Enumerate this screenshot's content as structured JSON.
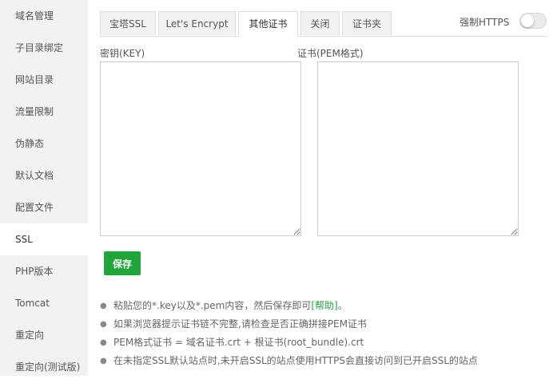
{
  "sidebar": {
    "items": [
      {
        "label": "域名管理"
      },
      {
        "label": "子目录绑定"
      },
      {
        "label": "网站目录"
      },
      {
        "label": "流量限制"
      },
      {
        "label": "伪静态"
      },
      {
        "label": "默认文档"
      },
      {
        "label": "配置文件"
      },
      {
        "label": "SSL"
      },
      {
        "label": "PHP版本"
      },
      {
        "label": "Tomcat"
      },
      {
        "label": "重定向"
      },
      {
        "label": "重定向(测试版)"
      }
    ],
    "active": "SSL"
  },
  "tabs": [
    {
      "label": "宝塔SSL"
    },
    {
      "label": "Let's Encrypt"
    },
    {
      "label": "其他证书"
    },
    {
      "label": "关闭"
    },
    {
      "label": "证书夹"
    }
  ],
  "active_tab": "其他证书",
  "force_https": {
    "label": "强制HTTPS",
    "enabled": false
  },
  "key_field": {
    "label": "密钥(KEY)",
    "value": ""
  },
  "cert_field": {
    "label": "证书(PEM格式)",
    "value": ""
  },
  "save_button": {
    "label": "保存"
  },
  "tips": {
    "tip1_prefix": "粘贴您的*.key以及*.pem内容，然后保存即可",
    "tip1_link": "[帮助]",
    "tip1_suffix": "。",
    "tip2": "如果浏览器提示证书链不完整,请检查是否正确拼接PEM证书",
    "tip3": "PEM格式证书 = 域名证书.crt + 根证书(root_bundle).crt",
    "tip4": "在未指定SSL默认站点时,未开启SSL的站点使用HTTPS会直接访问到已开启SSL的站点",
    "bullet": "●"
  },
  "colors": {
    "accent": "#20a53a",
    "sidebar_bg": "#f2f2f2",
    "tab_bg": "#f2f2f2"
  }
}
